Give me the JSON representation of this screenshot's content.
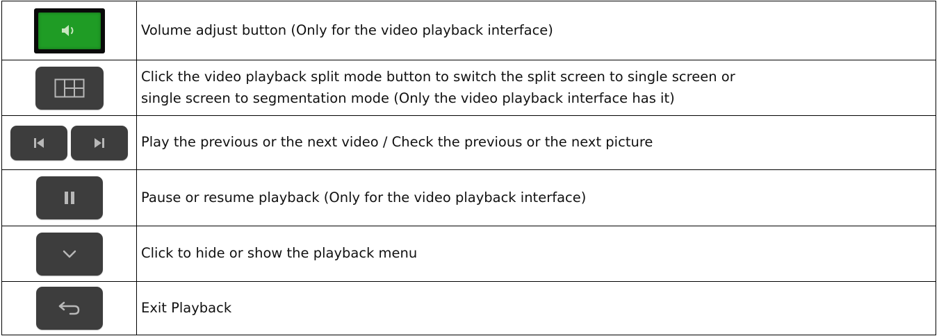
{
  "rows": [
    {
      "icon": "volume-icon",
      "color": "#1f9c25",
      "text": "Volume adjust button (Only for the video playback interface)"
    },
    {
      "icon": "split-screen-icon",
      "text_line1": "Click the video playback split mode button to switch the split screen to single screen or",
      "text_line2": "single screen to segmentation mode (Only the video playback interface has it)"
    },
    {
      "icon": [
        "previous-icon",
        "next-icon"
      ],
      "text": "Play the previous or the next video / Check the previous or the next picture"
    },
    {
      "icon": "pause-icon",
      "text": "Pause or resume playback (Only for the video playback interface)"
    },
    {
      "icon": "chevron-down-icon",
      "text": "Click to hide or show the playback menu"
    },
    {
      "icon": "return-icon",
      "text": "Exit Playback"
    }
  ],
  "colors": {
    "button_bg": "#3d3d3d",
    "volume_bg": "#1f9c25",
    "icon_fg": "#b8b8b8"
  }
}
